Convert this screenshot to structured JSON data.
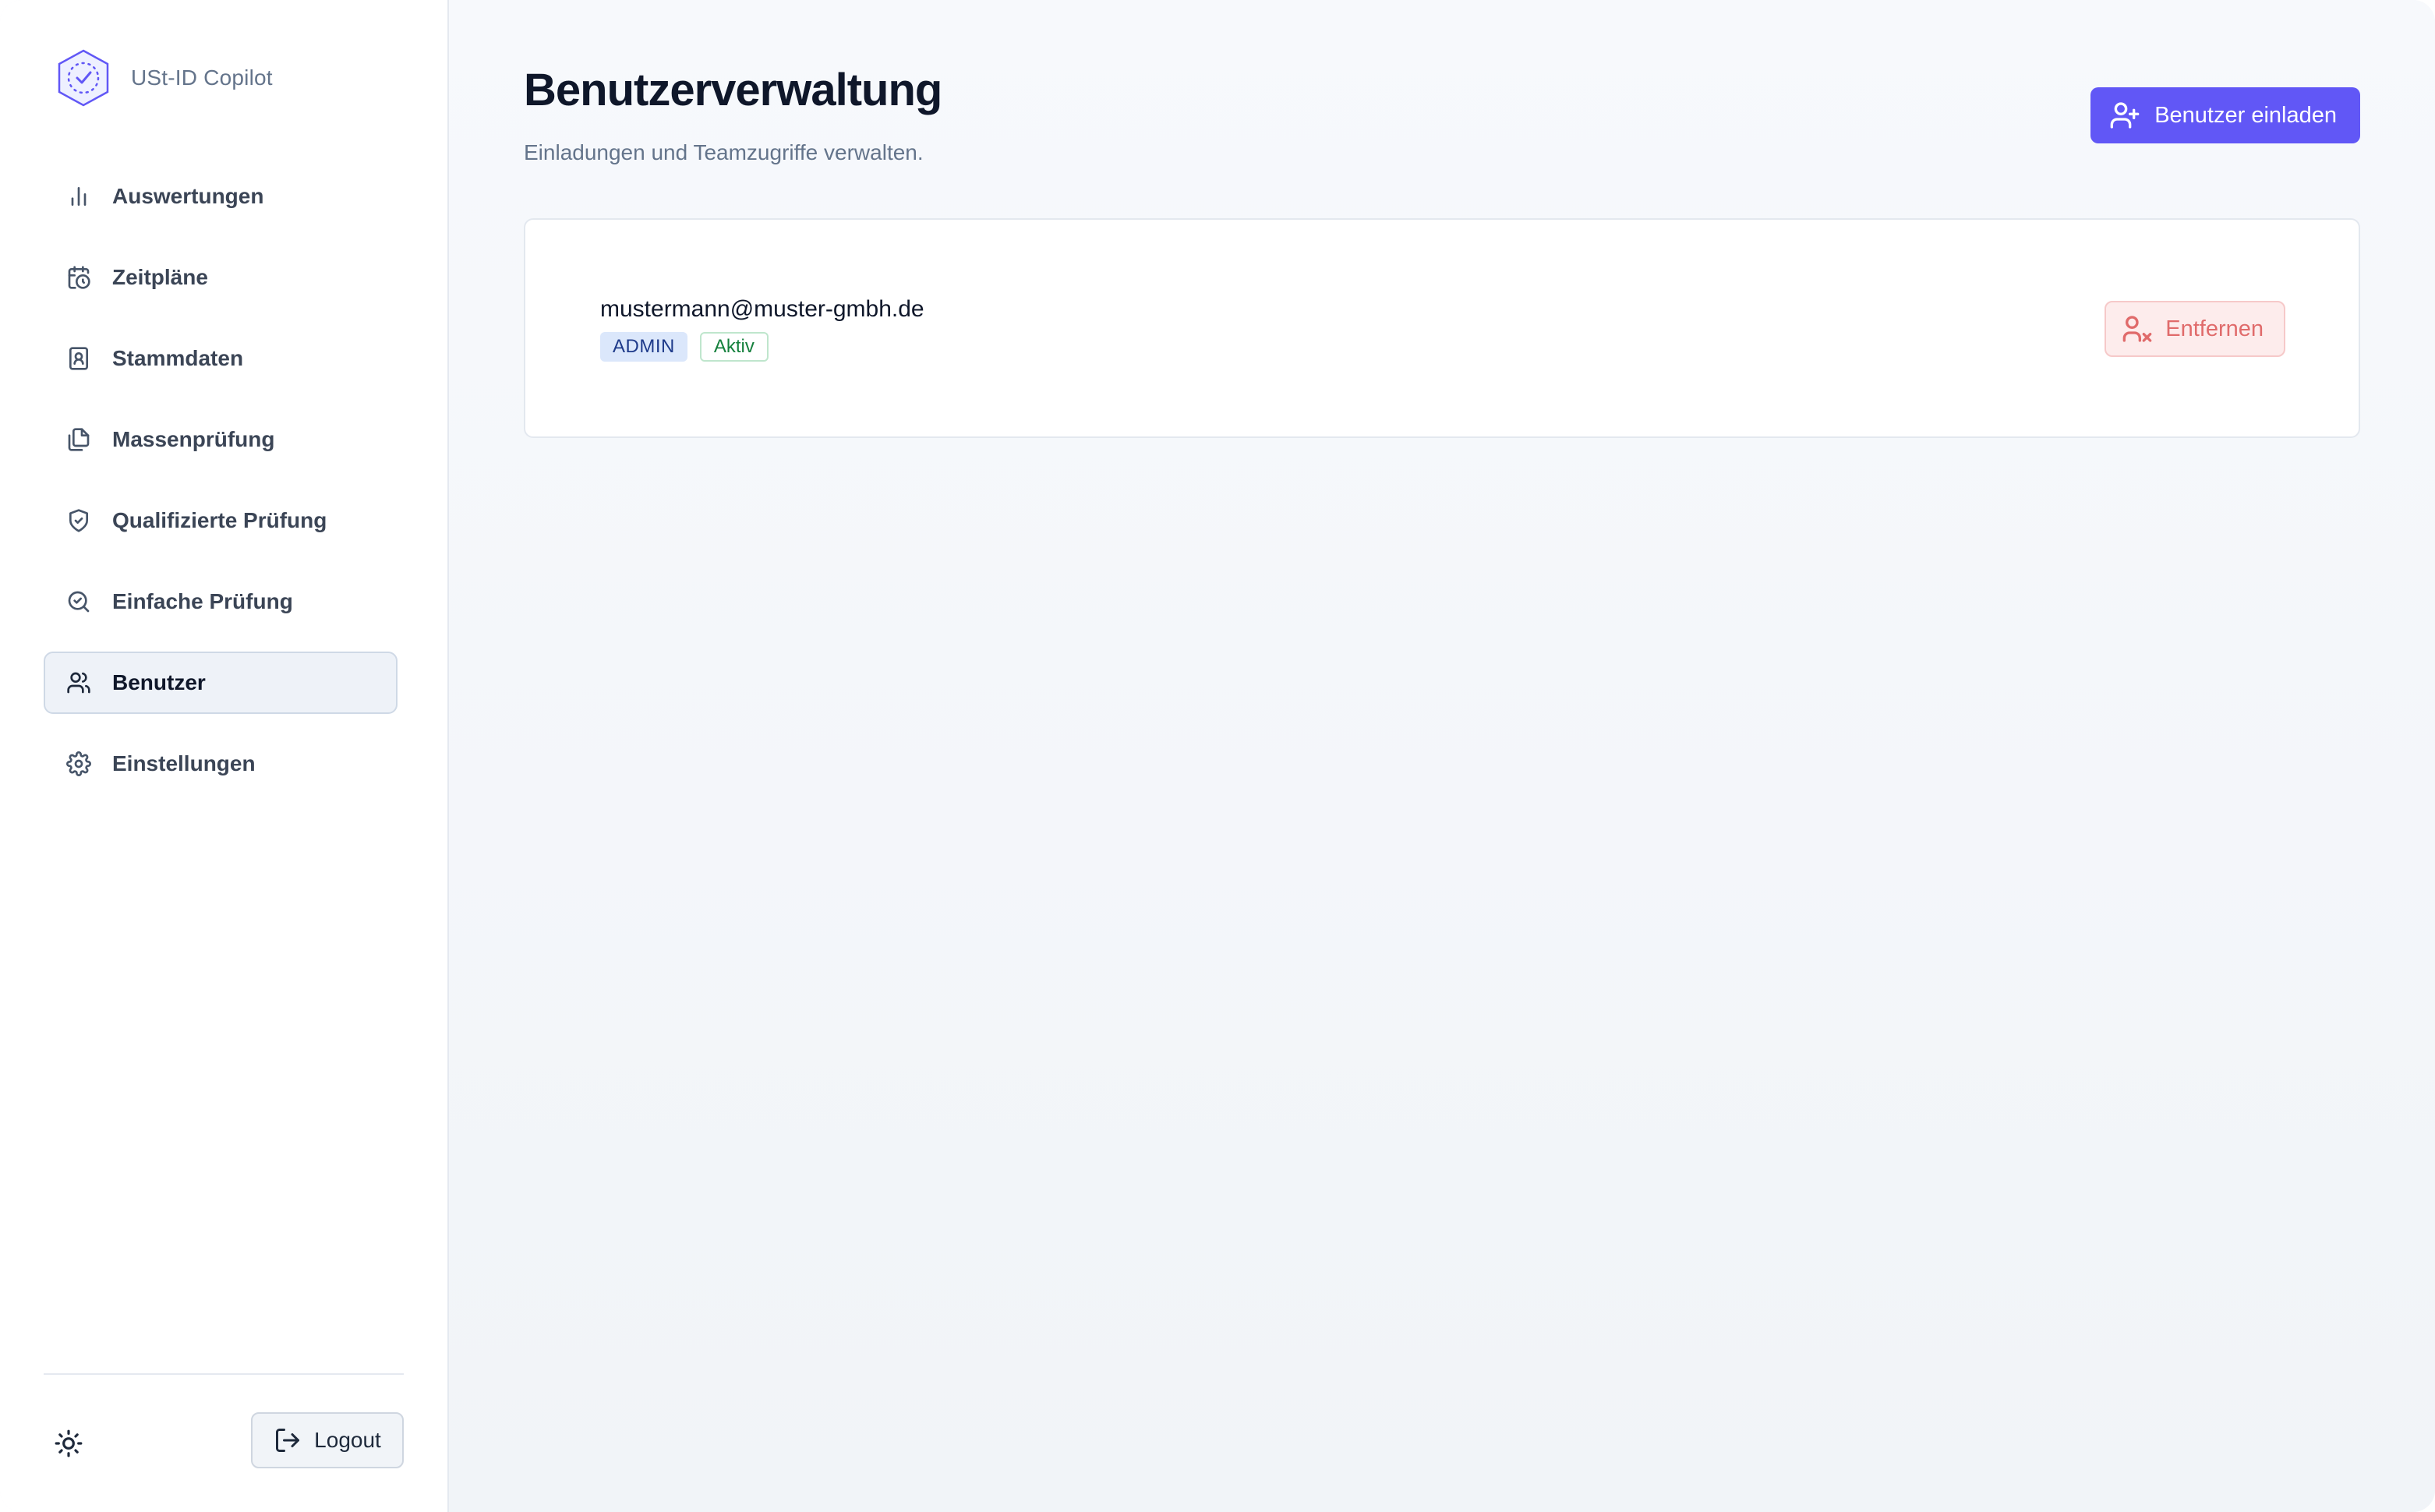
{
  "app": {
    "name": "USt-ID Copilot",
    "accent_color": "#6157f6"
  },
  "sidebar": {
    "items": [
      {
        "label": "Auswertungen",
        "icon": "bar-chart-icon",
        "active": false
      },
      {
        "label": "Zeitpläne",
        "icon": "calendar-clock-icon",
        "active": false
      },
      {
        "label": "Stammdaten",
        "icon": "contact-book-icon",
        "active": false
      },
      {
        "label": "Massenprüfung",
        "icon": "files-icon",
        "active": false
      },
      {
        "label": "Qualifizierte Prüfung",
        "icon": "shield-check-icon",
        "active": false
      },
      {
        "label": "Einfache Prüfung",
        "icon": "search-check-icon",
        "active": false
      },
      {
        "label": "Benutzer",
        "icon": "users-icon",
        "active": true
      },
      {
        "label": "Einstellungen",
        "icon": "gear-icon",
        "active": false
      }
    ],
    "theme_toggle_icon": "sun-icon",
    "logout_label": "Logout",
    "logout_icon": "logout-icon"
  },
  "main": {
    "title": "Benutzerverwaltung",
    "subtitle": "Einladungen und Teamzugriffe verwalten.",
    "invite_button": {
      "label": "Benutzer einladen",
      "icon": "user-plus-icon"
    },
    "users": [
      {
        "email": "mustermann@muster-gmbh.de",
        "role": "ADMIN",
        "status": "Aktiv",
        "remove_label": "Entfernen",
        "remove_icon": "user-x-icon"
      }
    ]
  }
}
